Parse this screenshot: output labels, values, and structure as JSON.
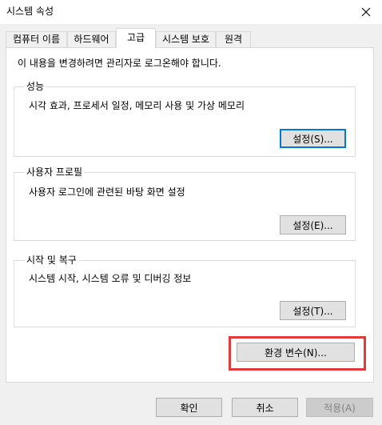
{
  "window": {
    "title": "시스템 속성"
  },
  "tabs": [
    {
      "label": "컴퓨터 이름"
    },
    {
      "label": "하드웨어"
    },
    {
      "label": "고급"
    },
    {
      "label": "시스템 보호"
    },
    {
      "label": "원격"
    }
  ],
  "notice": "이 내용을 변경하려면 관리자로 로그온해야 합니다.",
  "groups": {
    "performance": {
      "label": "성능",
      "description": "시각 효과, 프로세서 일정, 메모리 사용 및 가상 메모리",
      "button": "설정(S)..."
    },
    "user_profiles": {
      "label": "사용자 프로필",
      "description": "사용자 로그인에 관련된 바탕 화면 설정",
      "button": "설정(E)..."
    },
    "startup_recovery": {
      "label": "시작 및 복구",
      "description": "시스템 시작, 시스템 오류 및 디버깅 정보",
      "button": "설정(T)..."
    }
  },
  "env_button": "환경 변수(N)...",
  "footer": {
    "ok": "확인",
    "cancel": "취소",
    "apply": "적용(A)"
  },
  "colors": {
    "highlight": "#e03a3a",
    "focus": "#0078d7"
  }
}
